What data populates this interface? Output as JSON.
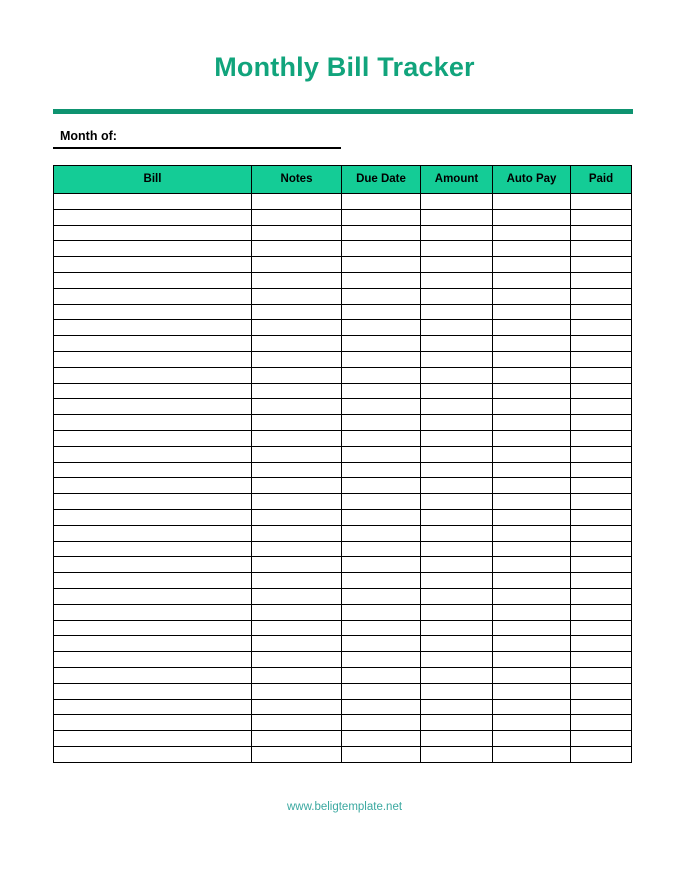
{
  "document": {
    "title": "Monthly Bill Tracker",
    "title_color": "#11a47c",
    "divider_color": "#0e9370",
    "footer_text": "www.beligtemplate.net",
    "footer_color": "#3aa8a0"
  },
  "form": {
    "month_label": "Month of:",
    "month_value": ""
  },
  "table": {
    "header_bg": "#14cc96",
    "border_color": "#000000",
    "row_count": 36,
    "columns": [
      {
        "key": "bill",
        "label": "Bill"
      },
      {
        "key": "notes",
        "label": "Notes"
      },
      {
        "key": "due",
        "label": "Due Date"
      },
      {
        "key": "amount",
        "label": "Amount"
      },
      {
        "key": "autopay",
        "label": "Auto Pay"
      },
      {
        "key": "paid",
        "label": "Paid"
      }
    ],
    "rows": []
  }
}
